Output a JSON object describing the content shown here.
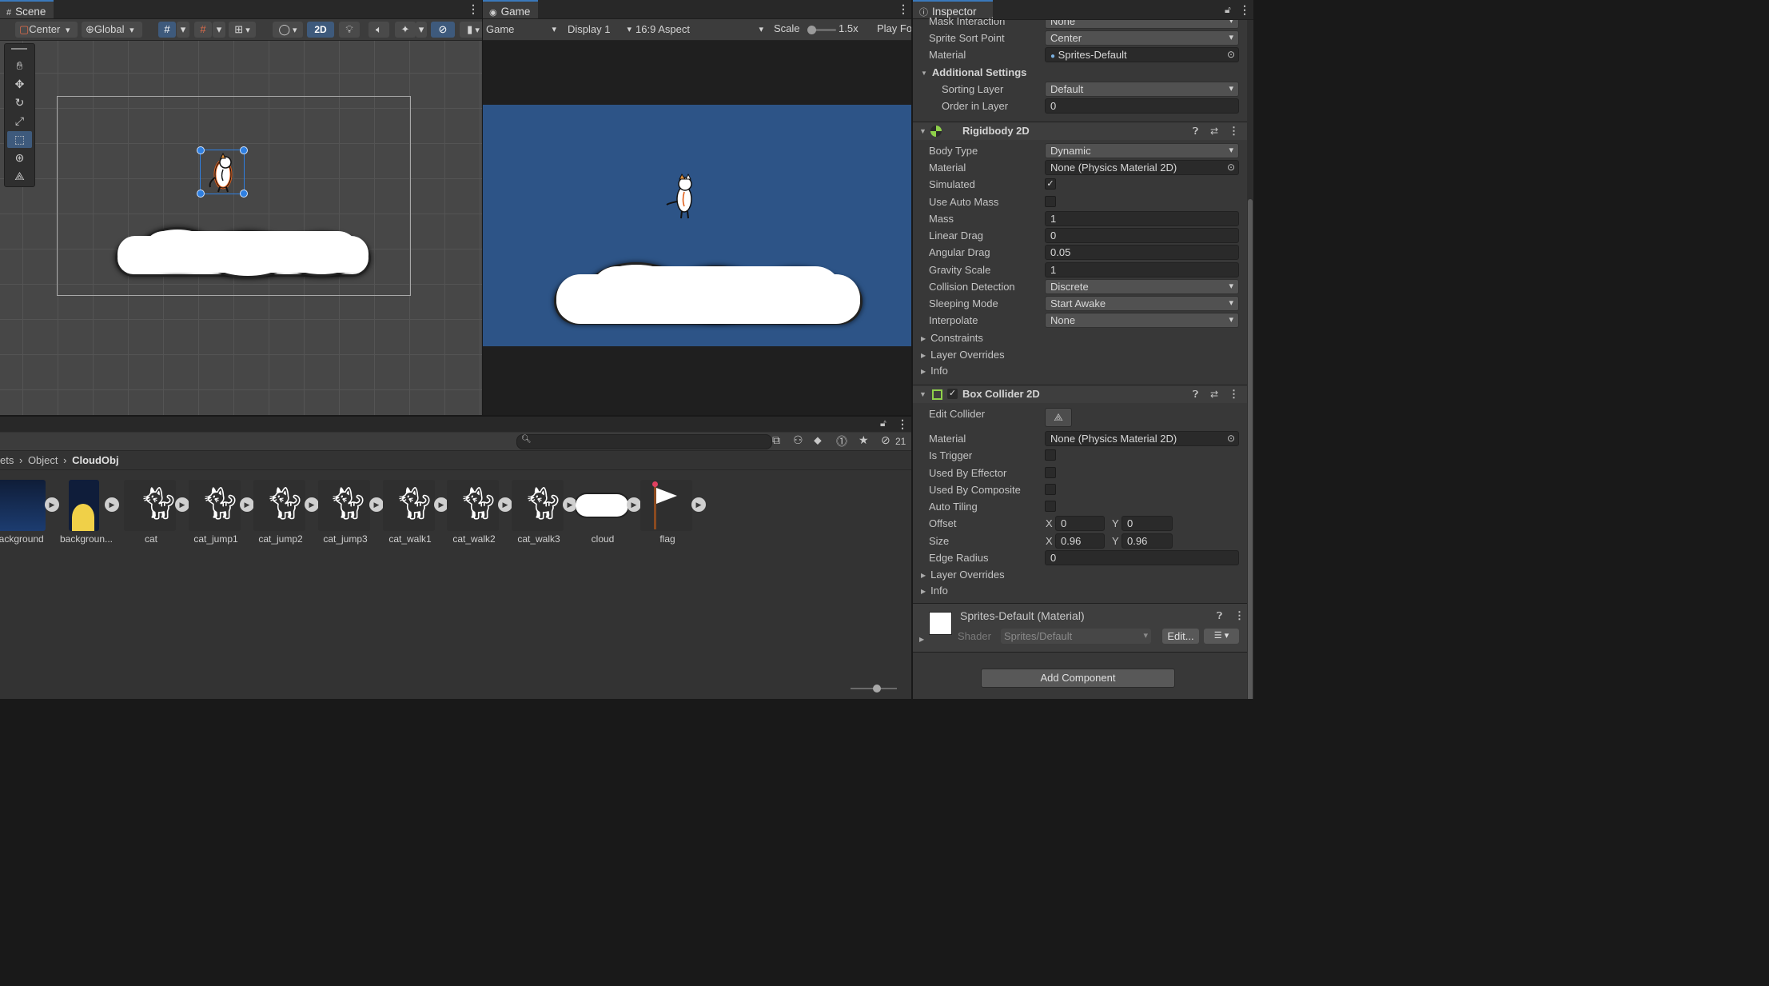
{
  "scene": {
    "tab_label": "Scene",
    "pivot_mode": "Center",
    "pivot_rotation": "Global",
    "mode_2d": "2D"
  },
  "game": {
    "tab_label": "Game",
    "view_select": "Game",
    "display": "Display 1",
    "aspect": "16:9 Aspect",
    "scale_label": "Scale",
    "scale_value": "1.5x",
    "play_focused": "Play Fo"
  },
  "project": {
    "visible_count": "21",
    "breadcrumb": [
      "ets",
      "Object",
      "CloudObj"
    ],
    "assets": [
      {
        "name": "background"
      },
      {
        "name": "backgroun..."
      },
      {
        "name": "cat"
      },
      {
        "name": "cat_jump1"
      },
      {
        "name": "cat_jump2"
      },
      {
        "name": "cat_jump3"
      },
      {
        "name": "cat_walk1"
      },
      {
        "name": "cat_walk2"
      },
      {
        "name": "cat_walk3"
      },
      {
        "name": "cloud"
      },
      {
        "name": "flag"
      }
    ]
  },
  "inspector": {
    "tab_label": "Inspector",
    "sprite_renderer": {
      "mask_interaction_label": "Mask Interaction",
      "mask_interaction": "None",
      "sprite_sort_point_label": "Sprite Sort Point",
      "sprite_sort_point": "Center",
      "material_label": "Material",
      "material": "Sprites-Default",
      "additional_settings": "Additional Settings",
      "sorting_layer_label": "Sorting Layer",
      "sorting_layer": "Default",
      "order_in_layer_label": "Order in Layer",
      "order_in_layer": "0"
    },
    "rigidbody": {
      "title": "Rigidbody 2D",
      "body_type_label": "Body Type",
      "body_type": "Dynamic",
      "material_label": "Material",
      "material": "None (Physics Material 2D)",
      "simulated_label": "Simulated",
      "use_auto_mass_label": "Use Auto Mass",
      "mass_label": "Mass",
      "mass": "1",
      "linear_drag_label": "Linear Drag",
      "linear_drag": "0",
      "angular_drag_label": "Angular Drag",
      "angular_drag": "0.05",
      "gravity_scale_label": "Gravity Scale",
      "gravity_scale": "1",
      "collision_detection_label": "Collision Detection",
      "collision_detection": "Discrete",
      "sleeping_mode_label": "Sleeping Mode",
      "sleeping_mode": "Start Awake",
      "interpolate_label": "Interpolate",
      "interpolate": "None",
      "constraints": "Constraints",
      "layer_overrides": "Layer Overrides",
      "info": "Info"
    },
    "box_collider": {
      "title": "Box Collider 2D",
      "edit_collider_label": "Edit Collider",
      "material_label": "Material",
      "material": "None (Physics Material 2D)",
      "is_trigger_label": "Is Trigger",
      "used_by_effector_label": "Used By Effector",
      "used_by_composite_label": "Used By Composite",
      "auto_tiling_label": "Auto Tiling",
      "offset_label": "Offset",
      "offset_x": "0",
      "offset_y": "0",
      "size_label": "Size",
      "size_x": "0.96",
      "size_y": "0.96",
      "x_label": "X",
      "y_label": "Y",
      "edge_radius_label": "Edge Radius",
      "edge_radius": "0",
      "layer_overrides": "Layer Overrides",
      "info": "Info"
    },
    "material_preview": {
      "title": "Sprites-Default (Material)",
      "shader_label": "Shader",
      "shader": "Sprites/Default",
      "edit_button": "Edit..."
    },
    "add_component": "Add Component"
  },
  "colors": {
    "accent": "#3a79bb",
    "game_background": "#2d5487",
    "selection_handle": "#2f7fe0"
  }
}
